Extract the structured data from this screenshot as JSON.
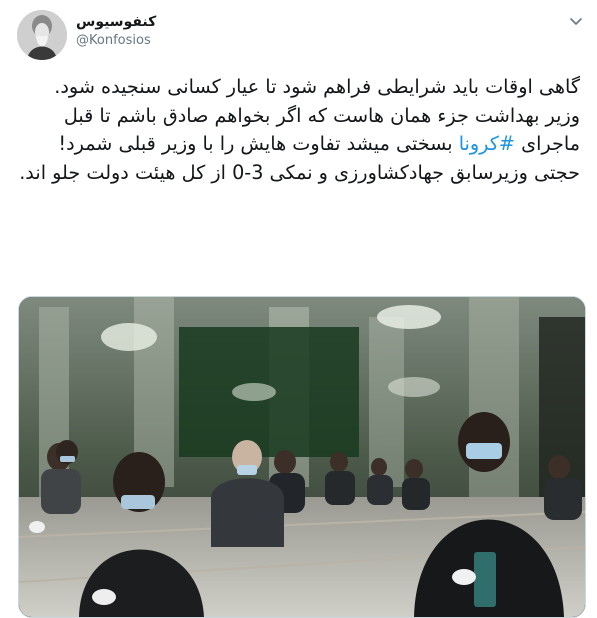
{
  "author": {
    "display_name": "کنفوسیوس",
    "handle": "@Konfosios"
  },
  "tweet": {
    "line1": "گاهی اوقات باید شرایطی فراهم شود تا عیار کسانی سنجیده شود.",
    "line2": "وزیر بهداشت جزء همان هاست که اگر بخواهم صادق باشم تا قبل ماجرای ",
    "hashtag": "#کرونا",
    "line2b": " بسختی میشد تفاوت هایش را با وزیر قبلی شمرد!",
    "line3": "حجتی وزیرسابق جهادکشاورزی و نمکی 3-0 از کل هیئت دولت جلو اند."
  },
  "icons": {
    "caret": "chevron-down-icon"
  },
  "colors": {
    "link": "#1b95e0",
    "secondary_text": "#657786"
  }
}
